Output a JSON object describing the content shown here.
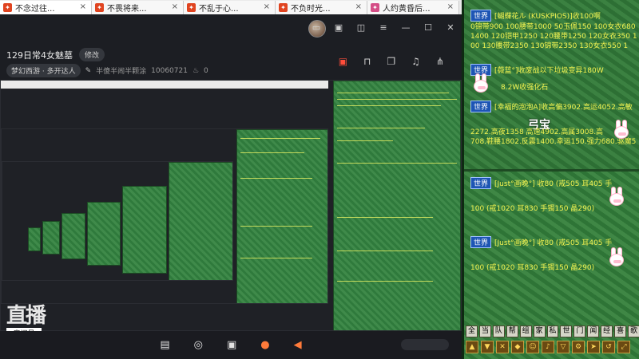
{
  "browser": {
    "tabs": [
      {
        "label": "不念过往...",
        "icon": "app-icon"
      },
      {
        "label": "不畏将来...",
        "icon": "app-icon"
      },
      {
        "label": "不乱于心...",
        "icon": "app-icon"
      },
      {
        "label": "不负时光...",
        "icon": "app-icon"
      },
      {
        "label": "人约黄昏后...",
        "icon": "app-icon"
      }
    ],
    "close_glyph": "×"
  },
  "window_controls": {
    "minimize": "—",
    "maximize": "☐",
    "close": "✕"
  },
  "room": {
    "title": "129日常4女魅墓",
    "edit_label": "修改",
    "game_chip": "梦幻西游 · 多开达人",
    "subtitle": "半傻半闹半颗涂",
    "room_id": "10060721",
    "heat": "0"
  },
  "logo": {
    "text": "直播",
    "tag": "房间号",
    "room_id": "10060721"
  },
  "game_chat": {
    "channel_label": "世界",
    "messages": [
      {
        "text": "[蝴蝶花ル (KUSKPIOS)]收100啊",
        "color": "yellow"
      },
      {
        "text": "0锦带900 100腰带1000 50玉佩150 100女衣680",
        "color": "yellow"
      },
      {
        "text": "1400 120铠甲1250 120腰带1250 120女衣350 1",
        "color": "yellow"
      },
      {
        "text": "00 130腰带2350 130锦带2350 130女衣550 1",
        "color": "yellow"
      },
      {
        "text": "[薇蓝°]收废战以下垃圾变异180W",
        "color": "yellow"
      },
      {
        "text": "8.2W收强化石",
        "color": "yellow"
      },
      {
        "text": "[幸福的泡泡A]收高偏3902.高运4052.高敏",
        "color": "yellow"
      },
      {
        "text": "2272.高夜1358 高速4902.高属3008.高",
        "color": "yellow"
      },
      {
        "text": "708.鞋腰1802.反震1400.幸运150.强力680.驱魔5",
        "color": "yellow"
      },
      {
        "text": "[Just°画晚°] 收80 (戒505 耳405 手",
        "color": "yellow"
      },
      {
        "text": "100 (戒1020 耳830 手镯150 晶290)",
        "color": "yellow"
      },
      {
        "text": "[Just°画晚°] 收80 (戒505 耳405 手",
        "color": "yellow"
      },
      {
        "text": "100 (戒1020 耳830 手镯150 晶290)",
        "color": "yellow"
      }
    ],
    "stamp": "弓宝",
    "channel_buttons": [
      "全",
      "当",
      "队",
      "帮",
      "组",
      "家",
      "私",
      "世",
      "门",
      "闻",
      "经",
      "喜",
      "歌"
    ]
  },
  "colors": {
    "accent": "#ff4d3a",
    "chat_text": "#f3f351",
    "chat_bg": "#2e7436",
    "channel": "#1d55b4"
  }
}
